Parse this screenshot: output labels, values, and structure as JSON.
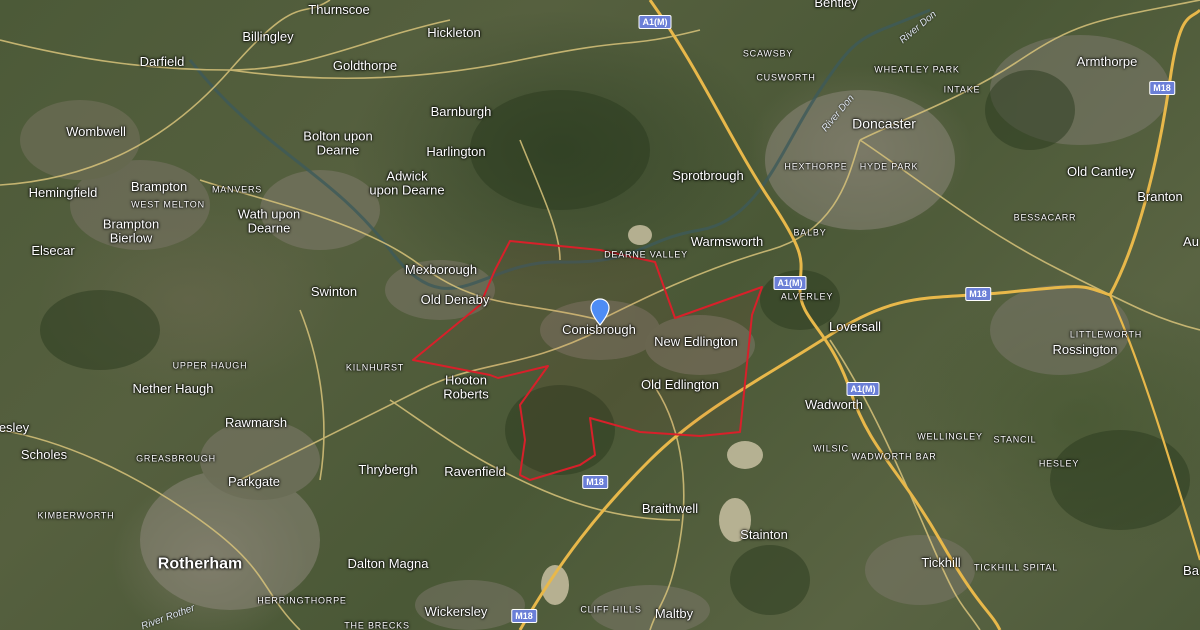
{
  "map": {
    "type": "satellite",
    "colors": {
      "boundary": "#d8202a",
      "pin": "#4d8cf5",
      "motorway": "#e8b84a",
      "road": "#d8c37a",
      "shield": "#6b7fd7"
    },
    "places": {
      "thurnscoe": "Thurnscoe",
      "hickleton": "Hickleton",
      "bentley": "Bentley",
      "billingley": "Billingley",
      "goldthorpe": "Goldthorpe",
      "darfield": "Darfield",
      "scawsby": "SCAWSBY",
      "cusworth": "CUSWORTH",
      "wheatley_park": "WHEATLEY PARK",
      "armthorpe": "Armthorpe",
      "intake": "INTAKE",
      "barnburgh": "Barnburgh",
      "wombwell": "Wombwell",
      "bolton_upon_dearne": "Bolton upon\nDearne",
      "doncaster": "Doncaster",
      "harlington": "Harlington",
      "hexthorpe": "HEXTHORPE",
      "hyde_park": "HYDE PARK",
      "old_cantley": "Old Cantley",
      "hemingfield": "Hemingfield",
      "brampton": "Brampton",
      "manvers": "MANVERS",
      "adwick_upon_dearne": "Adwick\nupon Dearne",
      "sprotbrough": "Sprotbrough",
      "branton": "Branton",
      "west_melton": "WEST MELTON",
      "brampton_bierlow": "Brampton\nBierlow",
      "wath_upon_dearne": "Wath upon\nDearne",
      "bessacarr": "BESSACARR",
      "warmsworth": "Warmsworth",
      "balby": "BALBY",
      "elsecar": "Elsecar",
      "dearne_valley": "DEARNE VALLEY",
      "mexborough": "Mexborough",
      "au": "Au",
      "swinton": "Swinton",
      "alverley": "ALVERLEY",
      "old_denaby": "Old Denaby",
      "loversall": "Loversall",
      "conisbrough": "Conisbrough",
      "littleworth": "LITTLEWORTH",
      "new_edlington": "New Edlington",
      "rossington": "Rossington",
      "upper_haugh": "UPPER HAUGH",
      "kilnhurst": "KILNHURST",
      "hooton_roberts": "Hooton\nRoberts",
      "nether_haugh": "Nether Haugh",
      "old_edlington": "Old Edlington",
      "wadworth": "Wadworth",
      "rawmarsh": "Rawmarsh",
      "wellingley": "WELLINGLEY",
      "stancil": "STANCIL",
      "esley": "esley",
      "scholes": "Scholes",
      "wilsic": "WILSIC",
      "wadworth_bar": "WADWORTH BAR",
      "greasbrough": "GREASBROUGH",
      "hesley": "HESLEY",
      "thrybergh": "Thrybergh",
      "ravenfield": "Ravenfield",
      "parkgate": "Parkgate",
      "braithwell": "Braithwell",
      "kimberworth": "KIMBERWORTH",
      "stainton": "Stainton",
      "tickhill": "Tickhill",
      "rotherham": "Rotherham",
      "dalton_magna": "Dalton Magna",
      "tickhill_spital": "TICKHILL SPITAL",
      "ba": "Ba",
      "herringthorpe": "HERRINGTHORPE",
      "wickersley": "Wickersley",
      "cliff_hills": "CLIFF HILLS",
      "maltby": "Maltby",
      "the_brecks": "THE BRECKS"
    },
    "roads": {
      "a1m_top": "A1(M)",
      "a1m_mid": "A1(M)",
      "a1m_low": "A1(M)",
      "m18_east": "M18",
      "m18_right": "M18",
      "m18_center": "M18",
      "m18_bottom": "M18"
    },
    "rivers": {
      "river_don": "River Don",
      "river_don_2": "River Don",
      "river_rother": "River Rother"
    },
    "marker_icon": "map-pin-icon"
  }
}
